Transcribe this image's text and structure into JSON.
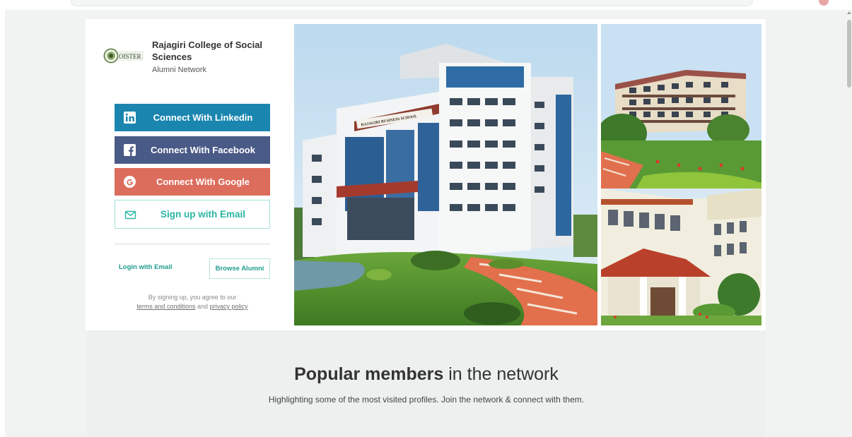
{
  "college": {
    "logo_text": "OISTER",
    "name": "Rajagiri College of Social Sciences",
    "network_label": "Alumni Network"
  },
  "auth": {
    "linkedin_label": "Connect With Linkedin",
    "facebook_label": "Connect With Facebook",
    "google_label": "Connect With Google",
    "email_signup_label": "Sign up with Email",
    "login_email_label": "Login with Email",
    "browse_alumni_label": "Browse Alumni",
    "terms_prefix": "By signing up, you agree to our",
    "terms_link": "terms and conditions",
    "terms_and": "and",
    "privacy_link": "privacy policy"
  },
  "photos": {
    "main_sign_text": "RAJAGIRI BUSINESS SCHOOL"
  },
  "popular": {
    "title_bold": "Popular members",
    "title_rest": " in the network",
    "subtitle": "Highlighting some of the most visited profiles. Join the network & connect with them."
  },
  "icons": [
    "linkedin-icon",
    "facebook-icon",
    "google-icon",
    "mail-icon"
  ],
  "colors": {
    "linkedin": "#1a86b0",
    "facebook": "#4a5a87",
    "google": "#dc6c5c",
    "accent": "#2ab5a3"
  }
}
